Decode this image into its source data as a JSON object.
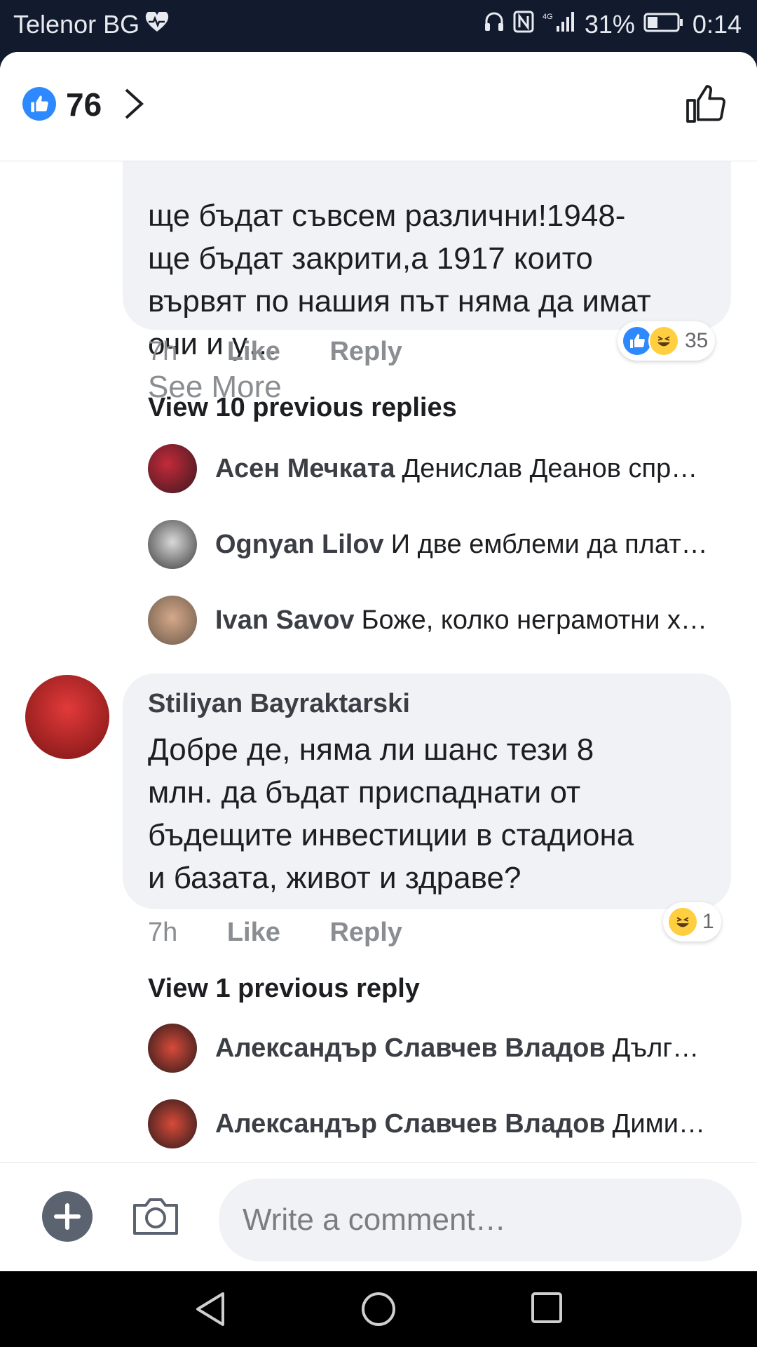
{
  "status_bar": {
    "carrier": "Telenor BG",
    "battery": "31%",
    "time": "0:14"
  },
  "header": {
    "like_count": "76"
  },
  "comments": [
    {
      "text_lines": "ще бъдат съвсем различни!1948-\nще бъдат закрити,а 1917 които\nвървят по нашия път няма да имат\nочи и у…",
      "see_more": "See More",
      "time": "7h",
      "like": "Like",
      "reply": "Reply",
      "reaction_count": "35",
      "view_previous": "View 10 previous replies",
      "replies": [
        {
          "name": "Асен Мечката",
          "text": "Денислав Деанов спр…"
        },
        {
          "name": "Ognyan Lilov",
          "text": "И две емблеми да плат…"
        },
        {
          "name": "Ivan Savov",
          "text": "Боже, колко неграмотни х…"
        }
      ]
    },
    {
      "author": "Stiliyan Bayraktarski",
      "text_lines": "Добре де, няма ли шанс тези 8\nмлн. да бъдат приспаднати от\nбъдещите инвестиции в стадиона\nи базата, живот и здраве?",
      "time": "7h",
      "like": "Like",
      "reply": "Reply",
      "reaction_count": "1",
      "view_previous": "View 1 previous reply",
      "replies": [
        {
          "name": "Александър Славчев Владов",
          "text": "Дълг…"
        },
        {
          "name": "Александър Славчев Владов",
          "text": "Дими…"
        }
      ]
    }
  ],
  "composer": {
    "placeholder": "Write a comment…"
  },
  "colors": {
    "accent": "#2e89ff",
    "bubble": "#f0f2f5",
    "status_bg": "#121b2e"
  }
}
